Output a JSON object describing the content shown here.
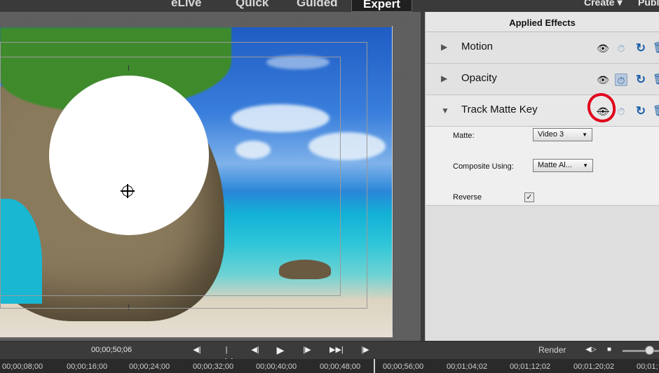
{
  "top_bar": {
    "tabs": [
      "eLive",
      "Quick",
      "Guided",
      "Expert"
    ],
    "active_tab": "Expert",
    "create_label": "Create ▾",
    "publish_label": "Publ"
  },
  "applied_effects": {
    "title": "Applied Effects",
    "effects": [
      {
        "name": "Motion",
        "expanded": false,
        "visible": true
      },
      {
        "name": "Opacity",
        "expanded": false,
        "visible": true
      },
      {
        "name": "Track Matte Key",
        "expanded": true,
        "visible": false
      }
    ],
    "track_matte_props": {
      "matte_label": "Matte:",
      "matte_value": "Video 3",
      "composite_label": "Composite Using:",
      "composite_value": "Matte Al...",
      "reverse_label": "Reverse",
      "reverse_checked": true
    }
  },
  "transport": {
    "timecode": "00;00;50;06",
    "render_label": "Render"
  },
  "timeline_ruler": [
    "00;00;08;00",
    "00;00;16;00",
    "00;00;24;00",
    "00;00;32;00",
    "00;00;40;00",
    "00;00;48;00",
    "00;00;56;00",
    "00;01;04;02",
    "00;01;12;02",
    "00;01;20;02",
    "00;01;"
  ],
  "colors": {
    "highlight_ring": "#e0001a",
    "accent_blue": "#1c5ea8"
  }
}
